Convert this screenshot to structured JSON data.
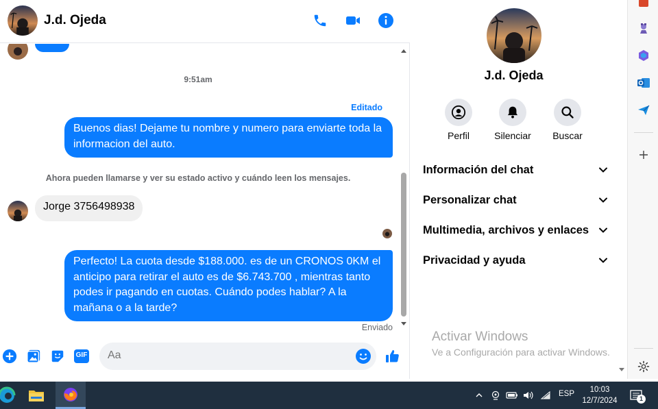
{
  "colors": {
    "accent": "#0a7cff",
    "incoming_bubble": "#f0f0f0",
    "taskbar": "#1f2f3f"
  },
  "contact": {
    "name": "J.d. Ojeda"
  },
  "header_icons": [
    "phone-icon",
    "video-camera-icon",
    "info-icon"
  ],
  "conversation": {
    "time_divider": "9:51am",
    "edited_label": "Editado",
    "messages": [
      {
        "direction": "out",
        "text": "Buenos dias! Dejame tu nombre y  numero para enviarte toda la informacion del auto."
      },
      {
        "direction": "in",
        "text": "Jorge 3756498938"
      },
      {
        "direction": "out",
        "text": "Perfecto! La cuota desde $188.000. es de un CRONOS 0KM el anticipo para retirar el auto es de $6.743.700 , mientras tanto podes ir pagando en cuotas. Cuándo podes hablar? A la mañana o a la tarde?"
      }
    ],
    "system_notice": "Ahora pueden llamarse y ver su estado activo y cuándo leen los mensajes.",
    "sent_status": "Enviado"
  },
  "composer": {
    "placeholder": "Aa",
    "gif_label": "GIF"
  },
  "info_panel": {
    "name": "J.d. Ojeda",
    "actions": [
      {
        "label": "Perfil",
        "icon": "profile-icon"
      },
      {
        "label": "Silenciar",
        "icon": "bell-icon"
      },
      {
        "label": "Buscar",
        "icon": "search-icon"
      }
    ],
    "sections": [
      "Información del chat",
      "Personalizar chat",
      "Multimedia, archivos y enlaces",
      "Privacidad y ayuda"
    ]
  },
  "watermark": {
    "title": "Activar Windows",
    "subtitle": "Ve a Configuración para activar Windows."
  },
  "taskbar": {
    "language": "ESP",
    "time": "10:03",
    "date": "12/7/2024",
    "notification_count": "1"
  }
}
